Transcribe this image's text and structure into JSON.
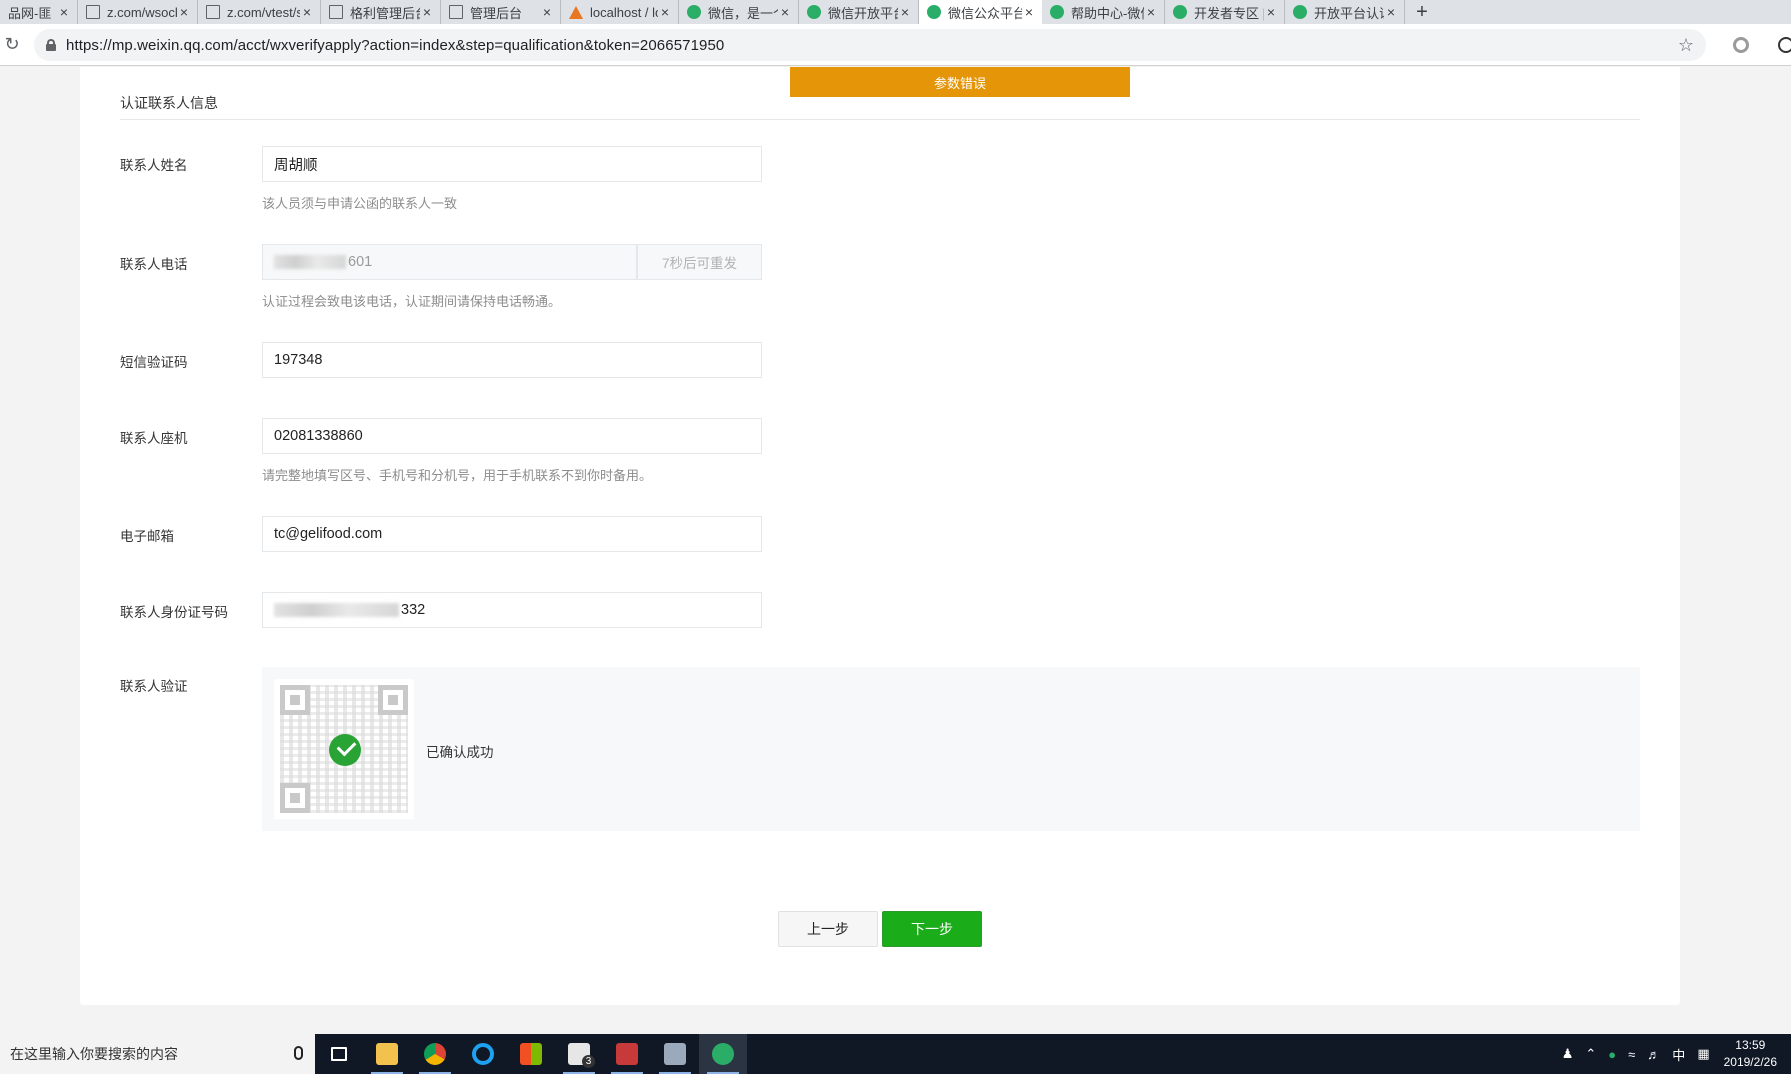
{
  "browser": {
    "tabs": [
      {
        "title": "品网-匪",
        "icon": "document-icon",
        "active": false
      },
      {
        "title": "z.com/wsock",
        "icon": "document-icon",
        "active": false
      },
      {
        "title": "z.com/vtest/s",
        "icon": "document-icon",
        "active": false
      },
      {
        "title": "格利管理后台",
        "icon": "document-icon",
        "active": false
      },
      {
        "title": "管理后台",
        "icon": "document-icon",
        "active": false
      },
      {
        "title": "localhost / lo",
        "icon": "phpmyadmin-icon",
        "active": false
      },
      {
        "title": "微信，是一个",
        "icon": "wechat-icon",
        "active": false
      },
      {
        "title": "微信开放平台",
        "icon": "wechat-icon",
        "active": false
      },
      {
        "title": "微信公众平台",
        "icon": "wechat-icon",
        "active": true
      },
      {
        "title": "帮助中心-微信",
        "icon": "wechat-icon",
        "active": false
      },
      {
        "title": "开发者专区 | ",
        "icon": "wechat-icon",
        "active": false
      },
      {
        "title": "开放平台认证",
        "icon": "wechat-icon",
        "active": false
      }
    ],
    "new_tab": "+",
    "url": "https://mp.weixin.qq.com/acct/wxverifyapply?action=index&step=qualification&token=2066571950"
  },
  "toast": {
    "text": "参数错误",
    "color": "#e59508"
  },
  "section": {
    "title": "认证联系人信息"
  },
  "form": {
    "name": {
      "label": "联系人姓名",
      "value": "周胡顺",
      "hint": "该人员须与申请公函的联系人一致"
    },
    "phone": {
      "label": "联系人电话",
      "value_suffix": "601",
      "resend": "7秒后可重发",
      "hint": "认证过程会致电该电话，认证期间请保持电话畅通。"
    },
    "sms": {
      "label": "短信验证码",
      "value": "197348"
    },
    "landline": {
      "label": "联系人座机",
      "value": "02081338860",
      "hint": "请完整地填写区号、手机号和分机号，用于手机联系不到你时备用。"
    },
    "email": {
      "label": "电子邮箱",
      "value": "tc@gelifood.com"
    },
    "id_number": {
      "label": "联系人身份证号码",
      "value_suffix": "332"
    },
    "verify": {
      "label": "联系人验证",
      "status": "已确认成功"
    }
  },
  "buttons": {
    "prev": "上一步",
    "next": "下一步"
  },
  "taskbar": {
    "search_placeholder": "在这里输入你要搜索的内容",
    "ime": "中",
    "time": "13:59",
    "date": "2019/2/26",
    "mail_badge": "3"
  },
  "colors": {
    "primary": "#1aad19",
    "warning": "#e59508"
  }
}
